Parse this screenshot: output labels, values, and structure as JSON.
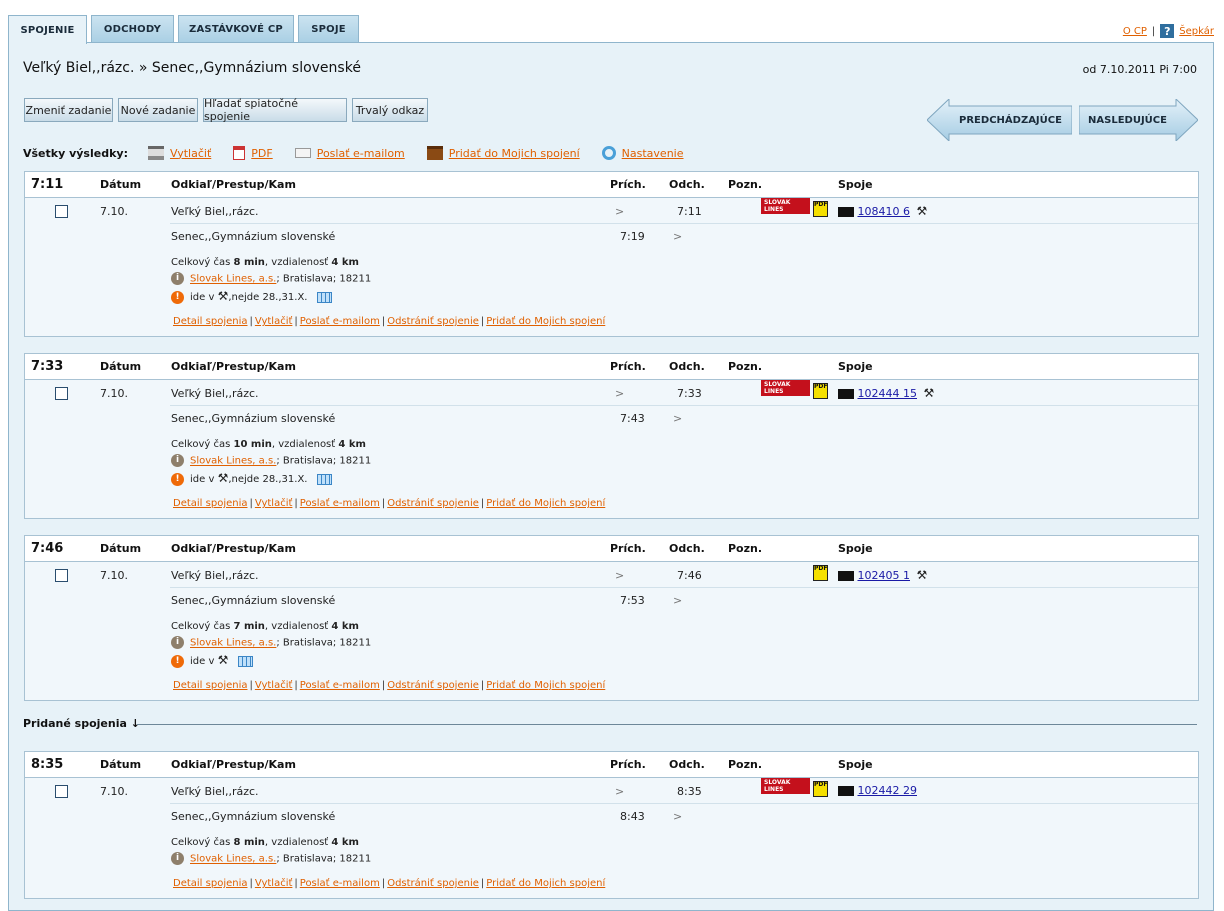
{
  "tabs": [
    {
      "label": "SPOJENIE",
      "active": true
    },
    {
      "label": "ODCHODY",
      "active": false
    },
    {
      "label": "ZASTÁVKOVÉ CP",
      "active": false
    },
    {
      "label": "SPOJE",
      "active": false
    }
  ],
  "top_links": {
    "about": "O CP",
    "help": "Šepkár",
    "help_icon": "?"
  },
  "route": {
    "title": "Veľký Biel,,rázc. » Senec,,Gymnázium slovenské",
    "date": "od 7.10.2011 Pi 7:00"
  },
  "buttons": {
    "change": "Zmeniť zadanie",
    "new": "Nové zadanie",
    "return": "Hľadať spiatočné spojenie",
    "permalink": "Trvalý odkaz",
    "prev": "PREDCHÁDZAJÚCE",
    "next": "NASLEDUJÚCE"
  },
  "actions": {
    "label": "Všetky výsledky:",
    "print": "Vytlačiť",
    "pdf": "PDF",
    "email": "Poslať e-mailom",
    "add": "Pridať do Mojich spojení",
    "settings": "Nastavenie"
  },
  "columns": {
    "date": "Dátum",
    "route": "Odkiaľ/Prestup/Kam",
    "arr": "Prích.",
    "dep": "Odch.",
    "note": "Pozn.",
    "trains": "Spoje"
  },
  "connections": [
    {
      "dep_time": "7:11",
      "date": "7.10.",
      "from": "Veľký Biel,,rázc.",
      "from_arr": ">",
      "from_dep": "7:11",
      "to": "Senec,,Gymnázium slovenské",
      "to_arr": "7:19",
      "to_dep": ">",
      "train": "108410 6",
      "has_logo": true,
      "has_tool": true,
      "total_prefix": "Celkový čas",
      "total_time": "8 min",
      "dist_prefix": ", vzdialenosť",
      "dist": "4 km",
      "operator": "Slovak Lines, a.s.",
      "operator_rest": "; Bratislava; 18211",
      "runs_prefix": "ide v",
      "runs_suffix": ",nejde 28.,31.X."
    },
    {
      "dep_time": "7:33",
      "date": "7.10.",
      "from": "Veľký Biel,,rázc.",
      "from_arr": ">",
      "from_dep": "7:33",
      "to": "Senec,,Gymnázium slovenské",
      "to_arr": "7:43",
      "to_dep": ">",
      "train": "102444 15",
      "has_logo": true,
      "has_tool": true,
      "total_prefix": "Celkový čas",
      "total_time": "10 min",
      "dist_prefix": ", vzdialenosť",
      "dist": "4 km",
      "operator": "Slovak Lines, a.s.",
      "operator_rest": "; Bratislava; 18211",
      "runs_prefix": "ide v",
      "runs_suffix": ",nejde 28.,31.X."
    },
    {
      "dep_time": "7:46",
      "date": "7.10.",
      "from": "Veľký Biel,,rázc.",
      "from_arr": ">",
      "from_dep": "7:46",
      "to": "Senec,,Gymnázium slovenské",
      "to_arr": "7:53",
      "to_dep": ">",
      "train": "102405 1",
      "has_logo": false,
      "has_tool": true,
      "total_prefix": "Celkový čas",
      "total_time": "7 min",
      "dist_prefix": ", vzdialenosť",
      "dist": "4 km",
      "operator": "Slovak Lines, a.s.",
      "operator_rest": "; Bratislava; 18211",
      "runs_prefix": "ide v",
      "runs_suffix": ""
    },
    {
      "dep_time": "8:35",
      "date": "7.10.",
      "from": "Veľký Biel,,rázc.",
      "from_arr": ">",
      "from_dep": "8:35",
      "to": "Senec,,Gymnázium slovenské",
      "to_arr": "8:43",
      "to_dep": ">",
      "train": "102442 29",
      "has_logo": true,
      "has_tool": false,
      "total_prefix": "Celkový čas",
      "total_time": "8 min",
      "dist_prefix": ", vzdialenosť",
      "dist": "4 km",
      "operator": "Slovak Lines, a.s.",
      "operator_rest": "; Bratislava; 18211",
      "runs_prefix": "",
      "runs_suffix": ""
    }
  ],
  "logo_text": "SLOVAK LINES",
  "pdf_text": "PDF",
  "tool_glyph": "⚒",
  "conn_links": {
    "detail": "Detail spojenia",
    "print": "Vytlačiť",
    "email": "Poslať e-mailom",
    "remove": "Odstrániť spojenie",
    "add": "Pridať do Mojich spojení"
  },
  "added_label": "Pridané spojenia ↓"
}
